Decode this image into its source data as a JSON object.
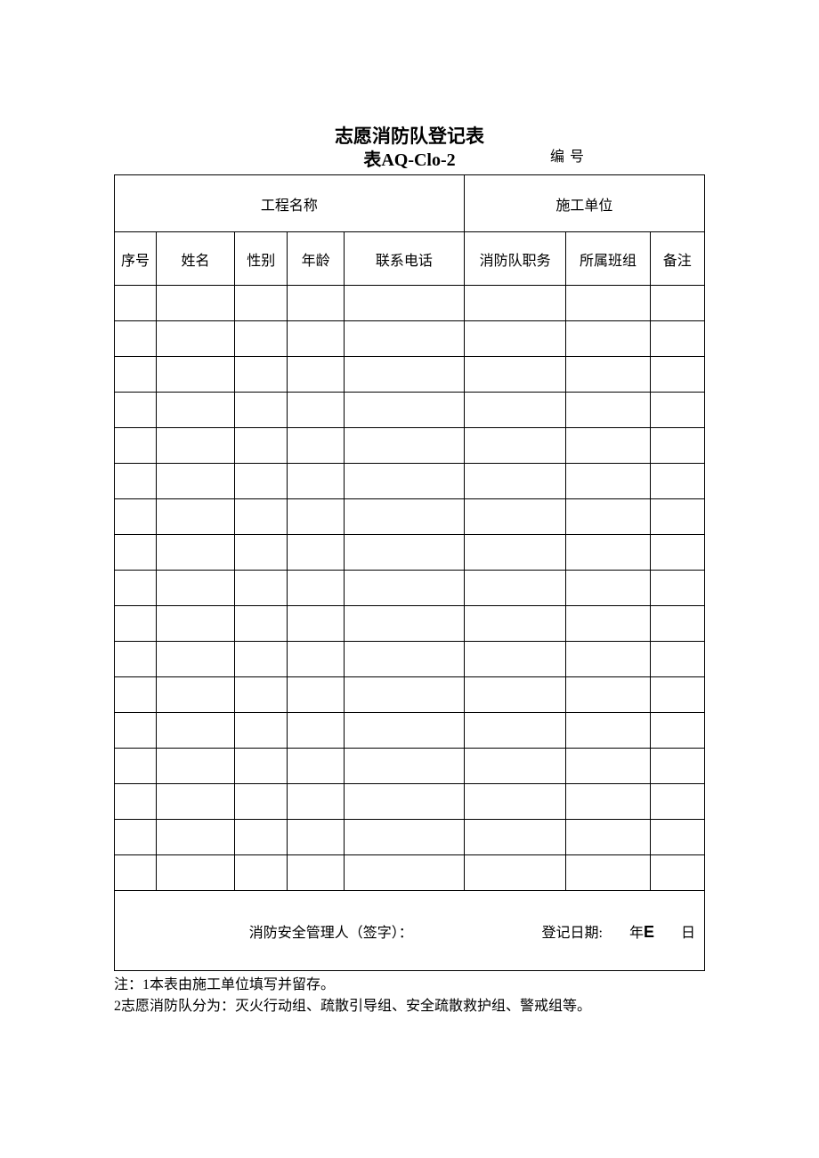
{
  "header": {
    "title_main": "志愿消防队登记表",
    "title_sub": "表AQ-Clo-2",
    "serial_label": "编号"
  },
  "top_labels": {
    "project_name": "工程名称",
    "construction_unit": "施工单位"
  },
  "columns": {
    "c1": "序号",
    "c2": "姓名",
    "c3": "性别",
    "c4": "年龄",
    "c5": "联系电话",
    "c6": "消防队职务",
    "c7": "所属班组",
    "c8": "备注"
  },
  "footer": {
    "signer_label": "消防安全管理人（签字）：",
    "date_label": "登记日期:",
    "year_unit": "年",
    "year_e": "E",
    "day_unit": "日"
  },
  "notes": {
    "line1": "注：1本表由施工单位填写并留存。",
    "line2": "2志愿消防队分为：灭火行动组、疏散引导组、安全疏散救护组、警戒组等。"
  }
}
